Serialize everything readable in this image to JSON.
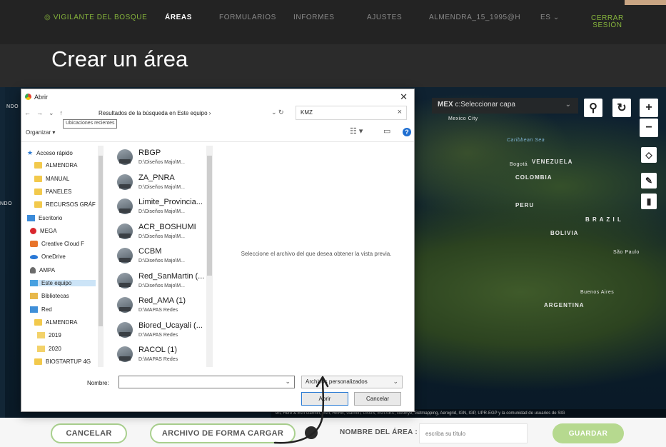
{
  "nav": {
    "brand": "VIGILANTE DEL BOSQUE",
    "areas": "ÁREAS",
    "forms": "FORMULARIOS",
    "reports": "INFORMES",
    "settings": "AJUSTES",
    "user": "ALMENDRA_15_1995@H",
    "lang": "ES ⌄",
    "logout_1": "CERRAR",
    "logout_2": "SESIÓN"
  },
  "page_title": "Crear un área",
  "map": {
    "layer_select": "c:Seleccionar capa",
    "labels": {
      "mexico_city": "Mexico City",
      "caribbean": "Caribbean Sea",
      "bogota": "Bogotá",
      "venezuela": "VENEZUELA",
      "colombia": "COLOMBIA",
      "peru": "PERU",
      "brazil": "B R A Z I L",
      "bolivia": "BOLIVIA",
      "sao_paulo": "São Paulo",
      "buenos_aires": "Buenos Aires",
      "argentina": "ARGENTINA",
      "edge_left": "NDO",
      "mex": "MEX"
    },
    "attribution": "ert, Here & Esri Garmin, Esri, HERE, Garmin, USGS, Esri AEX, GeoEye, Getmapping, Aerogrid, IGN, IGP, UPR-EGP y la comunidad de usuarios de SIG"
  },
  "bottom": {
    "cancel": "CANCELAR",
    "upload": "ARCHIVO DE FORMA CARGAR",
    "area_name_label": "NOMBRE DEL ÁREA :",
    "area_name_placeholder": "escriba su título",
    "save": "GUARDAR"
  },
  "dialog": {
    "title": "Abrir",
    "close": "✕",
    "path": "Resultados de la búsqueda en Este equipo  ›",
    "search_value": "KMZ",
    "tooltip": "Ubicaciones recientes",
    "organize": "Organizar ▾",
    "tree": [
      "Acceso rápido",
      "ALMENDRA",
      "MANUAL",
      "PANELES",
      "RECURSOS GRÁF",
      "Escritorio",
      "MEGA",
      "Creative Cloud F",
      "OneDrive",
      "AMPA",
      "Este equipo",
      "Bibliotecas",
      "Red",
      "ALMENDRA",
      "2019",
      "2020",
      "BIOSTARTUP 4G"
    ],
    "files": [
      {
        "name": "RBGP",
        "path": "D:\\Diseños Majo\\M..."
      },
      {
        "name": "ZA_PNRA",
        "path": "D:\\Diseños Majo\\M..."
      },
      {
        "name": "Limite_Provincia...",
        "path": "D:\\Diseños Majo\\M..."
      },
      {
        "name": "ACR_BOSHUMI",
        "path": "D:\\Diseños Majo\\M..."
      },
      {
        "name": "CCBM",
        "path": "D:\\Diseños Majo\\M..."
      },
      {
        "name": "Red_SanMartin (...",
        "path": "D:\\Diseños Majo\\M..."
      },
      {
        "name": "Red_AMA (1)",
        "path": "D:\\MAPAS Redes"
      },
      {
        "name": "Biored_Ucayali (...",
        "path": "D:\\MAPAS Redes"
      },
      {
        "name": "RACOL (1)",
        "path": "D:\\MAPAS Redes"
      }
    ],
    "preview_text": "Seleccione el archivo del que desea obtener la vista previa.",
    "name_label": "Nombre:",
    "filter": "Archivos personalizados",
    "open": "Abrir",
    "cancel": "Cancelar"
  },
  "colors": {
    "brand_green": "#86b43c",
    "button_border": "#a9d08e",
    "save_bg": "#b6d98f"
  }
}
